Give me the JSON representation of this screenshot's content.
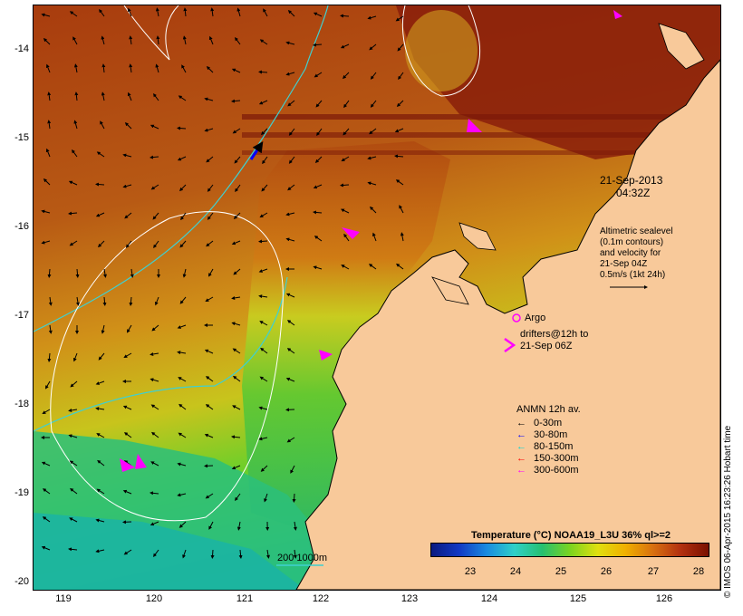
{
  "axes": {
    "lat_ticks": [
      "-14",
      "-15",
      "-16",
      "-17",
      "-18",
      "-19",
      "-20"
    ],
    "lon_ticks": [
      "119",
      "120",
      "121",
      "122",
      "123",
      "124",
      "125",
      "126"
    ]
  },
  "annotations": {
    "datetime_line1": "21-Sep-2013",
    "datetime_line2": "04:32Z",
    "altimetry_lines": [
      "Altimetric sealevel",
      "(0.1m contours)",
      "and velocity for",
      "21-Sep 04Z",
      "0.5m/s (1kt 24h)"
    ],
    "argo_label": "Argo",
    "drifters_line1": "drifters@12h to",
    "drifters_line2": "21-Sep 06Z",
    "bathymetry_label": "200  1000m"
  },
  "legend": {
    "title": "ANMN 12h av.",
    "items": [
      {
        "label": "0-30m",
        "color": "#000000"
      },
      {
        "label": "30-80m",
        "color": "#0000ff"
      },
      {
        "label": "80-150m",
        "color": "#00d8d8"
      },
      {
        "label": "150-300m",
        "color": "#ff0000"
      },
      {
        "label": "300-600m",
        "color": "#ff00ff"
      }
    ]
  },
  "colorbar": {
    "title": "Temperature (°C) NOAA19_L3U 36% ql>=2",
    "ticks": [
      "23",
      "24",
      "25",
      "26",
      "27",
      "28"
    ]
  },
  "credit": "© IMOS 06-Apr-2015 16:23:26 Hobart time",
  "colors": {
    "land": "#f8c99a",
    "warm_sst": "#a53a0c",
    "cool_sst": "#22c07a",
    "drifter": "#ff00ff",
    "contour_200m": "#3fd0d0",
    "sealevel_contour": "#ffffff"
  }
}
